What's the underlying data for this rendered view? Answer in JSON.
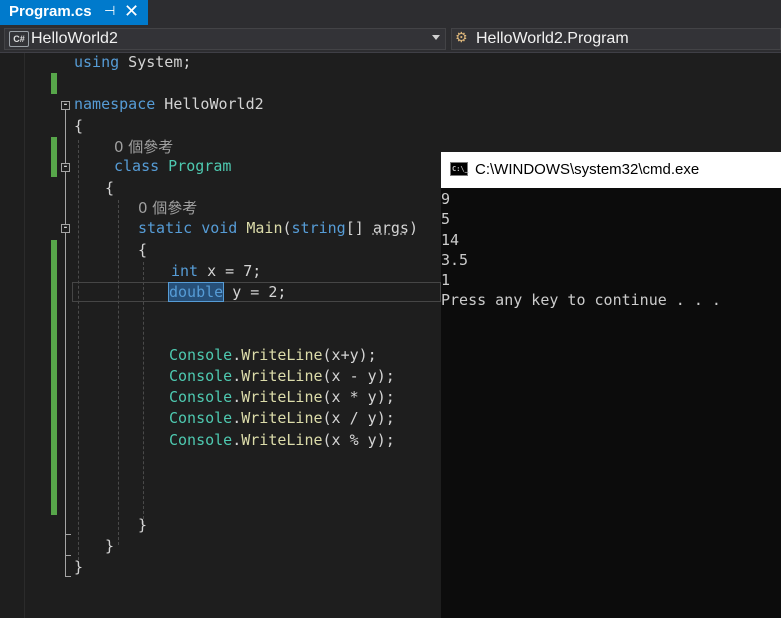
{
  "tab": {
    "label": "Program.cs",
    "pin_icon": "pin-icon",
    "close_icon": "close-icon",
    "close_glyph": "✕"
  },
  "navbar": {
    "project_badge": "C#",
    "project": "HelloWorld2",
    "class_icon": "class-scope-icon",
    "class": "HelloWorld2.Program"
  },
  "code": {
    "using_kw": "using",
    "using_rest": " System;",
    "namespace_kw": "namespace",
    "namespace_name": " HelloWorld2",
    "brace_open": "{",
    "brace_close": "}",
    "refs_class": "0 個參考",
    "class_kw": "class",
    "class_name": " Program",
    "refs_main": "0 個參考",
    "static_kw": "static",
    "void_kw": "void",
    "main_name": "Main",
    "paren_open": "(",
    "string_kw": "string",
    "args_bracket": "[] ",
    "args": "args",
    "paren_close": ")",
    "int_kw": "int",
    "x_decl": " x = 7;",
    "double_kw": "double",
    "y_decl": " y = 2;",
    "console": "Console",
    "dot": ".",
    "writeline": "WriteLine",
    "args_sum": "(x+y);",
    "args_diff": "(x - y);",
    "args_mul": "(x * y);",
    "args_div": "(x / y);",
    "args_mod": "(x % y);"
  },
  "cmd": {
    "title": "C:\\WINDOWS\\system32\\cmd.exe",
    "icon_text": "C:\\_",
    "output": [
      "9",
      "5",
      "14",
      "3.5",
      "1",
      "Press any key to continue . . ."
    ]
  },
  "colors": {
    "tab_active": "#007acc",
    "keyword": "#569cd6",
    "type": "#4ec9b0",
    "method": "#dcdcaa",
    "change_marker": "#57a64a",
    "editor_bg": "#1e1e1e"
  }
}
